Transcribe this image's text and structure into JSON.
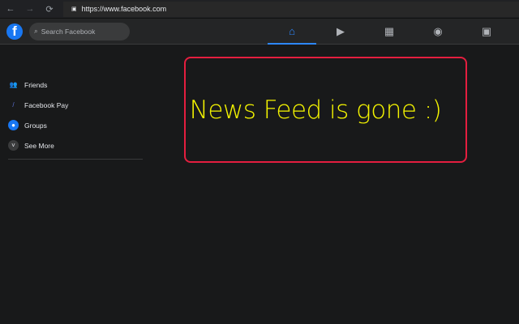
{
  "browser": {
    "url": "https://www.facebook.com",
    "back": "←",
    "forward": "→",
    "reload": "⟳",
    "lock": "🔒"
  },
  "header": {
    "logo": "f",
    "search_placeholder": "Search Facebook"
  },
  "sidebar": {
    "items": [
      {
        "label": "Friends",
        "icon": "friends-icon"
      },
      {
        "label": "Facebook Pay",
        "icon": "pay-icon"
      },
      {
        "label": "Groups",
        "icon": "groups-icon"
      },
      {
        "label": "See More",
        "icon": "chevron-down-icon"
      }
    ]
  },
  "message": "News Feed is gone :)",
  "colors": {
    "accent": "#2d88ff",
    "message": "#f5f500",
    "border": "#e41e3f"
  }
}
